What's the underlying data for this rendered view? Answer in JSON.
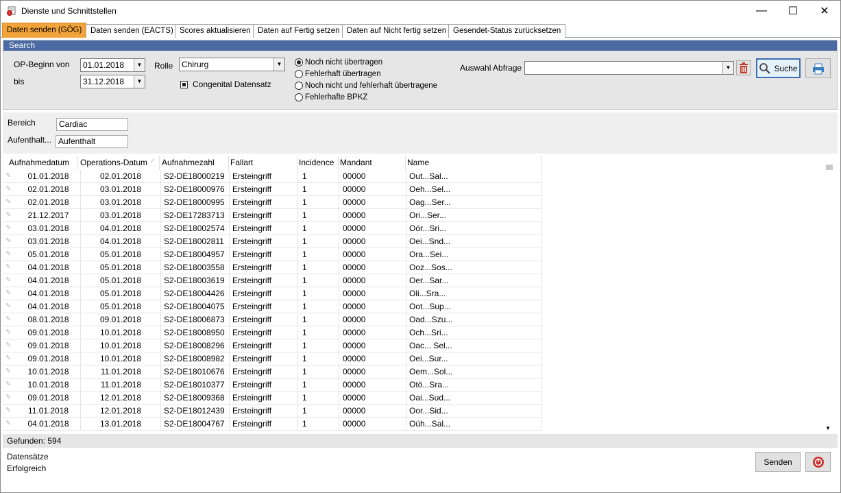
{
  "window": {
    "title": "Dienste und Schnittstellen",
    "minimize": "—",
    "maximize": "☐",
    "close": "✕"
  },
  "tabs": [
    "Daten senden (GÖG)",
    "Daten senden (EACTS)",
    "Scores aktualisieren",
    "Daten auf Fertig setzen",
    "Daten auf Nicht fertig setzen",
    "Gesendet-Status zurücksetzen"
  ],
  "search": {
    "header": "Search",
    "op_begin_label": "OP-Beginn von",
    "bis_label": "bis",
    "date_from": "01.01.2018",
    "date_to": "31.12.2018",
    "rolle_label": "Rolle",
    "rolle_value": "Chirurg",
    "congenital_label": "Congenital Datensatz",
    "radios": [
      "Noch nicht übertragen",
      "Fehlerhaft übertragen",
      "Noch nicht und fehlerhaft übertragene",
      "Fehlerhafte BPKZ"
    ],
    "auswahl_label": "Auswahl Abfrage",
    "auswahl_value": "",
    "suche_label": "Suche"
  },
  "filters": {
    "bereich_label": "Bereich",
    "bereich_value": "Cardiac",
    "aufenthalt_label": "Aufenthalt...",
    "aufenthalt_value": "Aufenthalt"
  },
  "table": {
    "columns": [
      "Aufnahmedatum",
      "Operations-Datum",
      "Aufnahmezahl",
      "Fallart",
      "Incidence",
      "Mandant",
      "Name"
    ],
    "rows": [
      [
        "01.01.2018",
        "02.01.2018",
        "S2-DE18000219",
        "Ersteingriff",
        "1",
        "00000",
        "Out...Sal..."
      ],
      [
        "02.01.2018",
        "03.01.2018",
        "S2-DE18000976",
        "Ersteingriff",
        "1",
        "00000",
        "Oeh...Sel..."
      ],
      [
        "02.01.2018",
        "03.01.2018",
        "S2-DE18000995",
        "Ersteingriff",
        "1",
        "00000",
        "Oag...Ser..."
      ],
      [
        "21.12.2017",
        "03.01.2018",
        "S2-DE17283713",
        "Ersteingriff",
        "1",
        "00000",
        "Ori...Ser..."
      ],
      [
        "03.01.2018",
        "04.01.2018",
        "S2-DE18002574",
        "Ersteingriff",
        "1",
        "00000",
        "Oör...Sri..."
      ],
      [
        "03.01.2018",
        "04.01.2018",
        "S2-DE18002811",
        "Ersteingriff",
        "1",
        "00000",
        "Oei...Snd..."
      ],
      [
        "05.01.2018",
        "05.01.2018",
        "S2-DE18004957",
        "Ersteingriff",
        "1",
        "00000",
        "Ora...Sei..."
      ],
      [
        "04.01.2018",
        "05.01.2018",
        "S2-DE18003558",
        "Ersteingriff",
        "1",
        "00000",
        "Ooz...Sos..."
      ],
      [
        "04.01.2018",
        "05.01.2018",
        "S2-DE18003619",
        "Ersteingriff",
        "1",
        "00000",
        "Oer...Sar..."
      ],
      [
        "04.01.2018",
        "05.01.2018",
        "S2-DE18004426",
        "Ersteingriff",
        "1",
        "00000",
        "Oli...Sra..."
      ],
      [
        "04.01.2018",
        "05.01.2018",
        "S2-DE18004075",
        "Ersteingriff",
        "1",
        "00000",
        "Oot...Sup..."
      ],
      [
        "08.01.2018",
        "09.01.2018",
        "S2-DE18006873",
        "Ersteingriff",
        "1",
        "00000",
        "Oad...Szu..."
      ],
      [
        "09.01.2018",
        "10.01.2018",
        "S2-DE18008950",
        "Ersteingriff",
        "1",
        "00000",
        "Och...Sri..."
      ],
      [
        "09.01.2018",
        "10.01.2018",
        "S2-DE18008296",
        "Ersteingriff",
        "1",
        "00000",
        "Oac... Sel..."
      ],
      [
        "09.01.2018",
        "10.01.2018",
        "S2-DE18008982",
        "Ersteingriff",
        "1",
        "00000",
        "Oei...Sur..."
      ],
      [
        "10.01.2018",
        "11.01.2018",
        "S2-DE18010676",
        "Ersteingriff",
        "1",
        "00000",
        "Oem...Sol..."
      ],
      [
        "10.01.2018",
        "11.01.2018",
        "S2-DE18010377",
        "Ersteingriff",
        "1",
        "00000",
        "Otö...Sra..."
      ],
      [
        "09.01.2018",
        "12.01.2018",
        "S2-DE18009368",
        "Ersteingriff",
        "1",
        "00000",
        "Oai...Sud..."
      ],
      [
        "11.01.2018",
        "12.01.2018",
        "S2-DE18012439",
        "Ersteingriff",
        "1",
        "00000",
        "Oor...Sid..."
      ],
      [
        "04.01.2018",
        "13.01.2018",
        "S2-DE18004767",
        "Ersteingriff",
        "1",
        "00000",
        "Oüh...Sal..."
      ]
    ]
  },
  "footer": {
    "found": "Gefunden: 594",
    "status_line1": "Datensätze",
    "status_line2": "Erfolgreich",
    "senden_label": "Senden"
  }
}
